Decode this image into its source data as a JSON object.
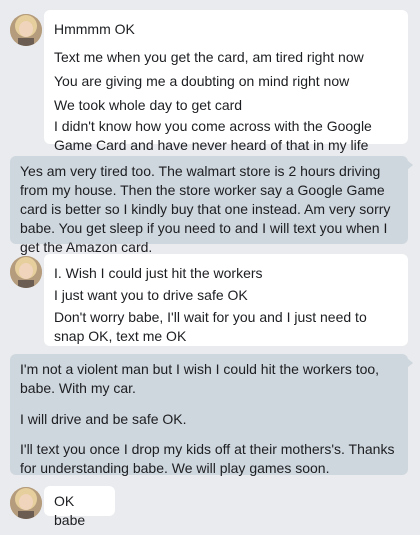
{
  "conversation": {
    "group1": {
      "messages": [
        "Hmmmm OK",
        "Text me when you get the card, am tired right now",
        "You are giving me a doubting on mind right now",
        "We took whole day to get card",
        "I didn't know how you come across with the Google Game Card and have never heard of that in my life"
      ]
    },
    "reply1": "Yes am very tired too. The walmart store is 2 hours driving from my house. Then the store worker say a Google Game card is better so I kindly buy that one instead. Am very sorry babe. You get sleep if you need to and I will text you when I get the Amazon card.",
    "group2": {
      "messages": [
        "I. Wish I could just hit the workers",
        "I just want you to drive safe OK",
        "Don't worry babe, I'll wait for you and I just need to snap OK, text me OK"
      ]
    },
    "reply2": {
      "paragraphs": [
        "I'm not a violent man but I wish I could hit the workers too, babe. With my car.",
        "I will drive and be safe OK.",
        "I'll text you once I drop my kids off at their mothers's. Thanks for understanding babe. We will play games soon."
      ]
    },
    "group3": {
      "messages": [
        "OK babe"
      ]
    }
  },
  "colors": {
    "background": "#e9ebee",
    "incoming_bubble": "#ffffff",
    "outgoing_bubble": "#cfd7de"
  }
}
